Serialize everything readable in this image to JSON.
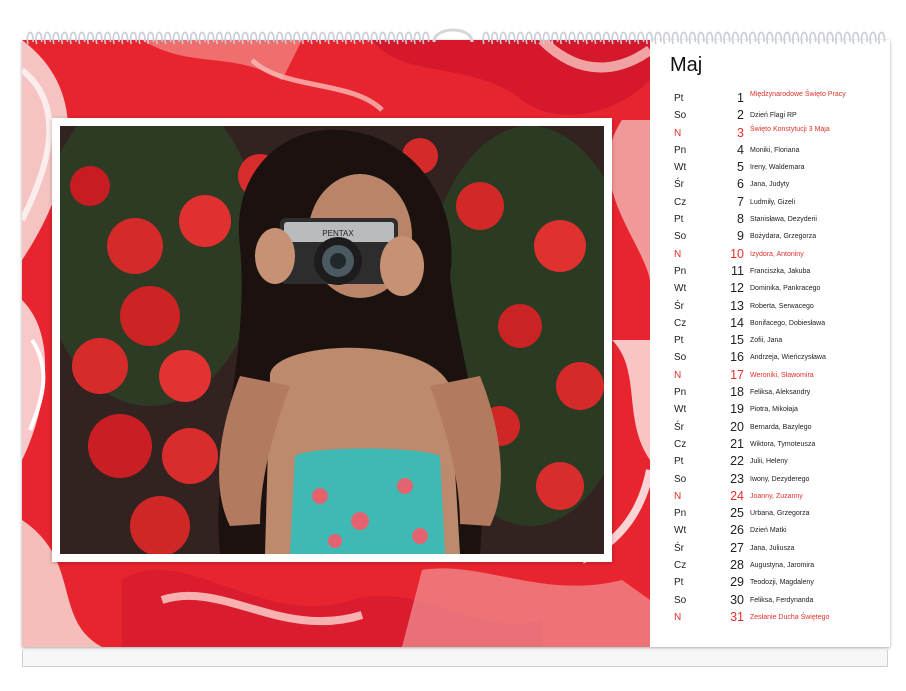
{
  "calendar": {
    "month": "Maj",
    "colors": {
      "accent_red": "#e0312a",
      "background": "#ffffff",
      "marble_red": "#e8252e",
      "marble_light": "#f3c9c6"
    },
    "days": [
      {
        "dow": "Pt",
        "num": "1",
        "names": "Międzynarodowe Święto Pracy",
        "holiday": true,
        "sunday": false
      },
      {
        "dow": "So",
        "num": "2",
        "names": "Dzień Flagi RP",
        "holiday": false,
        "sunday": false
      },
      {
        "dow": "N",
        "num": "3",
        "names": "Święto Konstytucji 3 Maja",
        "holiday": true,
        "sunday": true
      },
      {
        "dow": "Pn",
        "num": "4",
        "names": "Moniki, Floriana",
        "holiday": false,
        "sunday": false
      },
      {
        "dow": "Wt",
        "num": "5",
        "names": "Ireny, Waldemara",
        "holiday": false,
        "sunday": false
      },
      {
        "dow": "Śr",
        "num": "6",
        "names": "Jana, Judyty",
        "holiday": false,
        "sunday": false
      },
      {
        "dow": "Cz",
        "num": "7",
        "names": "Ludmiły, Gizeli",
        "holiday": false,
        "sunday": false
      },
      {
        "dow": "Pt",
        "num": "8",
        "names": "Stanisława, Dezyderii",
        "holiday": false,
        "sunday": false
      },
      {
        "dow": "So",
        "num": "9",
        "names": "Bożydara, Grzegorza",
        "holiday": false,
        "sunday": false
      },
      {
        "dow": "N",
        "num": "10",
        "names": "Izydora, Antoniny",
        "holiday": false,
        "sunday": true
      },
      {
        "dow": "Pn",
        "num": "11",
        "names": "Franciszka, Jakuba",
        "holiday": false,
        "sunday": false
      },
      {
        "dow": "Wt",
        "num": "12",
        "names": "Dominika, Pankracego",
        "holiday": false,
        "sunday": false
      },
      {
        "dow": "Śr",
        "num": "13",
        "names": "Roberta, Serwacego",
        "holiday": false,
        "sunday": false
      },
      {
        "dow": "Cz",
        "num": "14",
        "names": "Bonifacego, Dobiesława",
        "holiday": false,
        "sunday": false
      },
      {
        "dow": "Pt",
        "num": "15",
        "names": "Zofii, Jana",
        "holiday": false,
        "sunday": false
      },
      {
        "dow": "So",
        "num": "16",
        "names": "Andrzeja, Wieńczysława",
        "holiday": false,
        "sunday": false
      },
      {
        "dow": "N",
        "num": "17",
        "names": "Weroniki, Sławomira",
        "holiday": false,
        "sunday": true
      },
      {
        "dow": "Pn",
        "num": "18",
        "names": "Feliksa, Aleksandry",
        "holiday": false,
        "sunday": false
      },
      {
        "dow": "Wt",
        "num": "19",
        "names": "Piotra, Mikołaja",
        "holiday": false,
        "sunday": false
      },
      {
        "dow": "Śr",
        "num": "20",
        "names": "Bernarda, Bazylego",
        "holiday": false,
        "sunday": false
      },
      {
        "dow": "Cz",
        "num": "21",
        "names": "Wiktora, Tymoteusza",
        "holiday": false,
        "sunday": false
      },
      {
        "dow": "Pt",
        "num": "22",
        "names": "Julii, Heleny",
        "holiday": false,
        "sunday": false
      },
      {
        "dow": "So",
        "num": "23",
        "names": "Iwony, Dezyderego",
        "holiday": false,
        "sunday": false
      },
      {
        "dow": "N",
        "num": "24",
        "names": "Joanny, Zuzanny",
        "holiday": false,
        "sunday": true
      },
      {
        "dow": "Pn",
        "num": "25",
        "names": "Urbana, Grzegorza",
        "holiday": false,
        "sunday": false
      },
      {
        "dow": "Wt",
        "num": "26",
        "names": "Dzień Matki",
        "holiday": false,
        "sunday": false
      },
      {
        "dow": "Śr",
        "num": "27",
        "names": "Jana, Juliusza",
        "holiday": false,
        "sunday": false
      },
      {
        "dow": "Cz",
        "num": "28",
        "names": "Augustyna, Jaromira",
        "holiday": false,
        "sunday": false
      },
      {
        "dow": "Pt",
        "num": "29",
        "names": "Teodozji, Magdaleny",
        "holiday": false,
        "sunday": false
      },
      {
        "dow": "So",
        "num": "30",
        "names": "Feliksa, Ferdynanda",
        "holiday": false,
        "sunday": false
      },
      {
        "dow": "N",
        "num": "31",
        "names": "Zesłanie Ducha Świętego",
        "holiday": false,
        "sunday": true
      }
    ],
    "camera_brand": "PENTAX"
  }
}
